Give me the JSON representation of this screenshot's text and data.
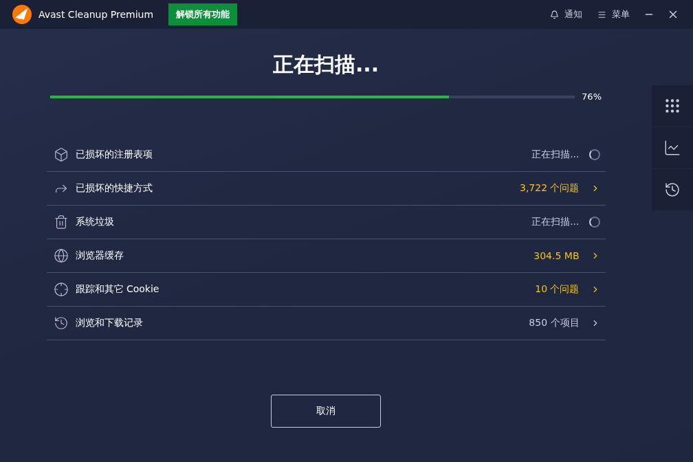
{
  "titlebar": {
    "app_name": "Avast Cleanup Premium",
    "unlock_button": "解锁所有功能",
    "notifications": "通知",
    "menu": "菜单"
  },
  "scan": {
    "title": "正在扫描...",
    "level": 0.76,
    "percent": "76%"
  },
  "items": [
    {
      "label": "已损坏的注册表项",
      "kind": "scanning",
      "status": "正在扫描..."
    },
    {
      "label": "已损坏的快捷方式",
      "kind": "found",
      "status": "3,722 个问题"
    },
    {
      "label": "系统垃圾",
      "kind": "scanning",
      "status": "正在扫描..."
    },
    {
      "label": "浏览器缓存",
      "kind": "found",
      "status": "304.5 MB"
    },
    {
      "label": "跟踪和其它 Cookie",
      "kind": "found",
      "status": "10 个问题"
    },
    {
      "label": "浏览和下载记录",
      "kind": "done",
      "status": "850 个项目"
    }
  ],
  "cancel_button": "取消"
}
